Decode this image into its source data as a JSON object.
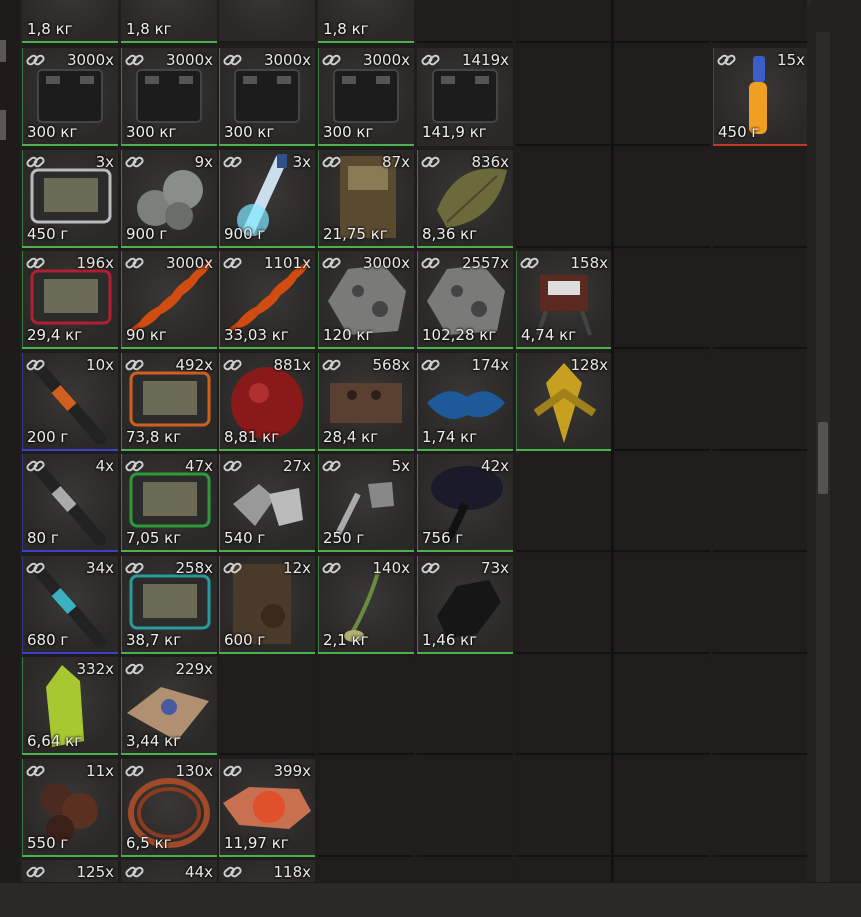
{
  "colors": {
    "bg": "#232120",
    "cell_bg": "#252423",
    "green": "#4caf50",
    "blue": "#3a43c8",
    "red": "#c0392b"
  },
  "columns": 8,
  "partial_top_row": {
    "weights": [
      "1,8 кг",
      "1,8 кг",
      "",
      "1,8 кг"
    ]
  },
  "rows": [
    [
      {
        "count": "3000x",
        "weight": "300 кг",
        "icon": "battery-icon",
        "accent": "green",
        "link": true
      },
      {
        "count": "3000x",
        "weight": "300 кг",
        "icon": "battery-icon",
        "accent": "green",
        "link": true
      },
      {
        "count": "3000x",
        "weight": "300 кг",
        "icon": "battery-icon",
        "accent": "green",
        "link": true
      },
      {
        "count": "3000x",
        "weight": "300 кг",
        "icon": "battery-icon",
        "accent": "green",
        "link": true
      },
      {
        "count": "1419x",
        "weight": "141,9 кг",
        "icon": "battery-icon",
        "accent": "none",
        "link": true
      },
      null,
      null,
      {
        "count": "15x",
        "weight": "450 г",
        "icon": "orange-vial-icon",
        "accent": "red",
        "link": true
      }
    ],
    [
      {
        "count": "3x",
        "weight": "450 г",
        "icon": "tablet-white-icon",
        "accent": "green",
        "link": true
      },
      {
        "count": "9x",
        "weight": "900 г",
        "icon": "gray-blob-icon",
        "accent": "green",
        "link": true
      },
      {
        "count": "3x",
        "weight": "900 г",
        "icon": "glowing-tube-icon",
        "accent": "green",
        "link": true
      },
      {
        "count": "87x",
        "weight": "21,75 кг",
        "icon": "crate-icon",
        "accent": "green",
        "link": true
      },
      {
        "count": "836x",
        "weight": "8,36 кг",
        "icon": "leaf-icon",
        "accent": "green",
        "link": true
      },
      null,
      null,
      null
    ],
    [
      {
        "count": "196x",
        "weight": "29,4 кг",
        "icon": "tablet-red-icon",
        "accent": "green",
        "link": true
      },
      {
        "count": "3000x",
        "weight": "90 кг",
        "icon": "orange-fern-icon",
        "accent": "green",
        "link": true
      },
      {
        "count": "1101x",
        "weight": "33,03 кг",
        "icon": "orange-fern-icon",
        "accent": "green",
        "link": true
      },
      {
        "count": "3000x",
        "weight": "120 кг",
        "icon": "rock-icon",
        "accent": "green",
        "link": true
      },
      {
        "count": "2557x",
        "weight": "102,28 кг",
        "icon": "rock-icon",
        "accent": "green",
        "link": true
      },
      {
        "count": "158x",
        "weight": "4,74 кг",
        "icon": "device-icon",
        "accent": "green",
        "link": true
      },
      null,
      null
    ],
    [
      {
        "count": "10x",
        "weight": "200 г",
        "icon": "injector-orange-icon",
        "accent": "blue",
        "link": true
      },
      {
        "count": "492x",
        "weight": "73,8 кг",
        "icon": "tablet-orange-icon",
        "accent": "green",
        "link": true
      },
      {
        "count": "881x",
        "weight": "8,81 кг",
        "icon": "red-orb-icon",
        "accent": "green",
        "link": true
      },
      {
        "count": "568x",
        "weight": "28,4 кг",
        "icon": "brick-icon",
        "accent": "green",
        "link": true
      },
      {
        "count": "174x",
        "weight": "1,74 кг",
        "icon": "blue-moss-icon",
        "accent": "green",
        "link": true
      },
      {
        "count": "128x",
        "weight": "",
        "icon": "yellow-plant-icon",
        "accent": "green",
        "link": false
      },
      null,
      null
    ],
    [
      {
        "count": "4x",
        "weight": "80 г",
        "icon": "injector-white-icon",
        "accent": "blue",
        "link": true
      },
      {
        "count": "47x",
        "weight": "7,05 кг",
        "icon": "tablet-green-icon",
        "accent": "green",
        "link": true
      },
      {
        "count": "27x",
        "weight": "540 г",
        "icon": "metal-scrap-icon",
        "accent": "green",
        "link": true
      },
      {
        "count": "5x",
        "weight": "250 г",
        "icon": "scrap-icon",
        "accent": "green",
        "link": true
      },
      {
        "count": "42x",
        "weight": "756 г",
        "icon": "dark-mushroom-icon",
        "accent": "green",
        "link": false
      },
      null,
      null,
      null
    ],
    [
      {
        "count": "34x",
        "weight": "680 г",
        "icon": "injector-teal-icon",
        "accent": "blue",
        "link": true
      },
      {
        "count": "258x",
        "weight": "38,7 кг",
        "icon": "tablet-teal-icon",
        "accent": "green",
        "link": true
      },
      {
        "count": "12x",
        "weight": "600 г",
        "icon": "rusted-panel-icon",
        "accent": "green",
        "link": true
      },
      {
        "count": "140x",
        "weight": "2,1 кг",
        "icon": "sprout-icon",
        "accent": "green",
        "link": true
      },
      {
        "count": "73x",
        "weight": "1,46 кг",
        "icon": "coal-icon",
        "accent": "green",
        "link": true
      },
      null,
      null,
      null
    ],
    [
      {
        "count": "332x",
        "weight": "6,64 кг",
        "icon": "green-crystal-icon",
        "accent": "green",
        "link": false
      },
      {
        "count": "229x",
        "weight": "3,44 кг",
        "icon": "cloth-icon",
        "accent": "green",
        "link": true
      },
      null,
      null,
      null,
      null,
      null,
      null
    ],
    [
      {
        "count": "11x",
        "weight": "550 г",
        "icon": "ore-cluster-icon",
        "accent": "green",
        "link": true
      },
      {
        "count": "130x",
        "weight": "6,5 кг",
        "icon": "wire-coil-icon",
        "accent": "green",
        "link": true
      },
      {
        "count": "399x",
        "weight": "11,97 кг",
        "icon": "orange-ore-icon",
        "accent": "green",
        "link": true
      },
      null,
      null,
      null,
      null,
      null
    ],
    [
      {
        "count": "125x",
        "weight": "",
        "icon": "item-icon",
        "accent": "none",
        "link": true
      },
      {
        "count": "44x",
        "weight": "",
        "icon": "item-icon",
        "accent": "none",
        "link": true
      },
      {
        "count": "118x",
        "weight": "",
        "icon": "item-icon",
        "accent": "none",
        "link": true
      },
      null,
      null,
      null,
      null,
      null
    ]
  ]
}
